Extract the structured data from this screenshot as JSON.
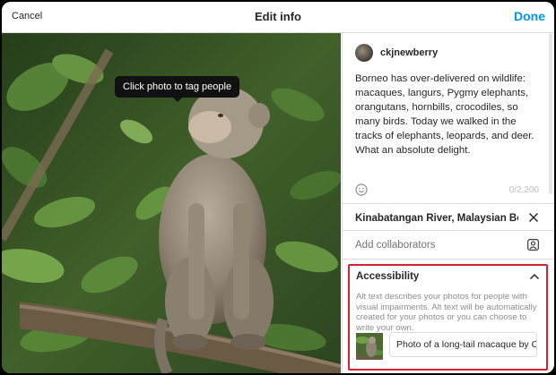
{
  "header": {
    "cancel_label": "Cancel",
    "title": "Edit info",
    "done_label": "Done"
  },
  "photo": {
    "tooltip": "Click photo to tag people"
  },
  "post": {
    "username": "ckjnewberry",
    "caption": "Borneo has over-delivered on wildlife: macaques, langurs, Pygmy elephants, orangutans, hornbills, crocodiles, so many birds. Today we walked in the tracks of elephants, leopards, and deer. What an absolute delight.",
    "char_count": "0/2,200",
    "emoji_icon": "smiley-icon"
  },
  "location": {
    "value": "Kinabatangan River, Malaysian Bor",
    "clear_icon": "close-icon"
  },
  "collaborators": {
    "label": "Add collaborators",
    "icon": "add-person-icon"
  },
  "accessibility": {
    "title": "Accessibility",
    "description": "Alt text describes your photos for people with visual impairments. Alt text will be automatically created for your photos or you can choose to write your own.",
    "alt_text_value": "Photo of a long-tail macaque by C",
    "chevron_icon": "chevron-up-icon"
  },
  "colors": {
    "accent": "#0095f6",
    "highlight_border": "#d9202f",
    "text": "#262626",
    "muted": "#8e8e8e"
  }
}
